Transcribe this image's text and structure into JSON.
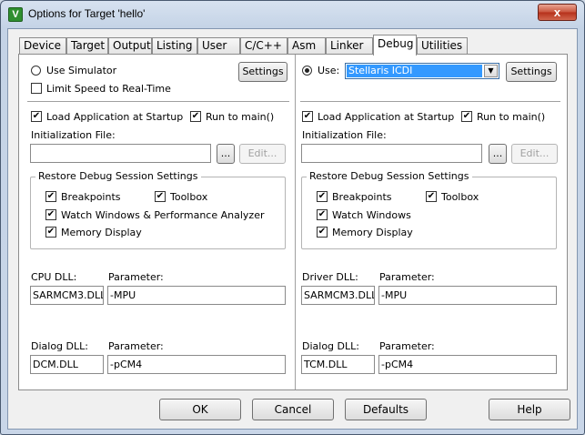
{
  "window": {
    "title": "Options for Target 'hello'",
    "app_icon_glyph": "V",
    "close_glyph": "x"
  },
  "tabs": [
    {
      "label": "Device"
    },
    {
      "label": "Target"
    },
    {
      "label": "Output"
    },
    {
      "label": "Listing"
    },
    {
      "label": "User"
    },
    {
      "label": "C/C++"
    },
    {
      "label": "Asm"
    },
    {
      "label": "Linker"
    },
    {
      "label": "Debug",
      "active": true
    },
    {
      "label": "Utilities"
    }
  ],
  "left": {
    "use_simulator": {
      "label": "Use Simulator",
      "selected": false
    },
    "limit_speed": {
      "label": "Limit Speed to Real-Time",
      "checked": false
    },
    "settings_label": "Settings",
    "load_app": {
      "label": "Load Application at Startup",
      "checked": true
    },
    "run_to_main": {
      "label": "Run to main()",
      "checked": true
    },
    "init_file_label": "Initialization File:",
    "init_file_value": "",
    "browse_label": "...",
    "edit_label": "Edit...",
    "restore_group_title": "Restore Debug Session Settings",
    "breakpoints": {
      "label": "Breakpoints",
      "checked": true
    },
    "toolbox": {
      "label": "Toolbox",
      "checked": true
    },
    "watch": {
      "label": "Watch Windows & Performance Analyzer",
      "checked": true
    },
    "memory": {
      "label": "Memory Display",
      "checked": true
    },
    "cpu_dll_label": "CPU DLL:",
    "cpu_dll_value": "SARMCM3.DLL",
    "cpu_param_label": "Parameter:",
    "cpu_param_value": "-MPU",
    "dialog_dll_label": "Dialog DLL:",
    "dialog_dll_value": "DCM.DLL",
    "dialog_param_label": "Parameter:",
    "dialog_param_value": "-pCM4"
  },
  "right": {
    "use": {
      "label": "Use:",
      "selected": true
    },
    "driver_selected": "Stellaris ICDI",
    "settings_label": "Settings",
    "load_app": {
      "label": "Load Application at Startup",
      "checked": true
    },
    "run_to_main": {
      "label": "Run to main()",
      "checked": true
    },
    "init_file_label": "Initialization File:",
    "init_file_value": "",
    "browse_label": "...",
    "edit_label": "Edit...",
    "restore_group_title": "Restore Debug Session Settings",
    "breakpoints": {
      "label": "Breakpoints",
      "checked": true
    },
    "toolbox": {
      "label": "Toolbox",
      "checked": true
    },
    "watch": {
      "label": "Watch Windows",
      "checked": true
    },
    "memory": {
      "label": "Memory Display",
      "checked": true
    },
    "driver_dll_label": "Driver DLL:",
    "driver_dll_value": "SARMCM3.DLL",
    "driver_param_label": "Parameter:",
    "driver_param_value": "-MPU",
    "dialog_dll_label": "Dialog DLL:",
    "dialog_dll_value": "TCM.DLL",
    "dialog_param_label": "Parameter:",
    "dialog_param_value": "-pCM4"
  },
  "buttons": {
    "ok": "OK",
    "cancel": "Cancel",
    "defaults": "Defaults",
    "help": "Help"
  },
  "colors": {
    "selection": "#3399ff",
    "close_button": "#c9533c"
  },
  "check_glyph": "✔"
}
